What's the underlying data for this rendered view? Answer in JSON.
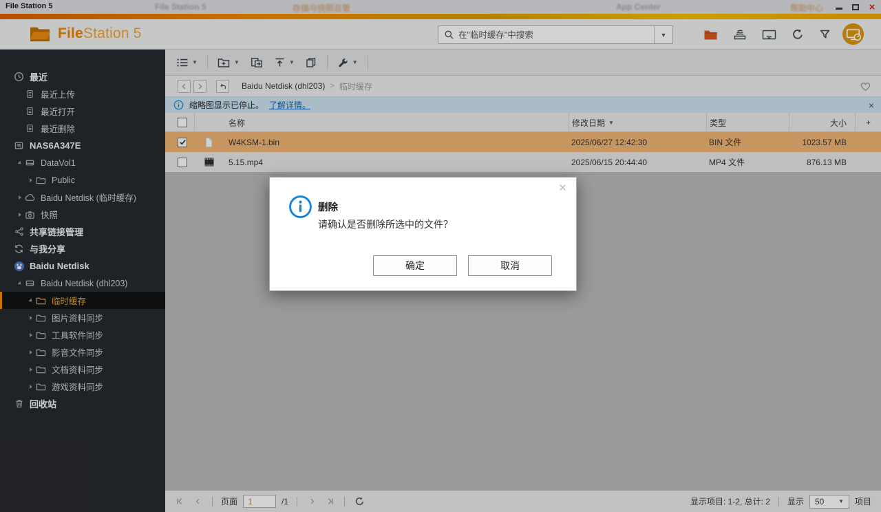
{
  "colors": {
    "accent_orange": "#ef8a00",
    "logo_orange": "#e98200",
    "selection_row": "#eeb273",
    "sidebar_bg": "#26292e",
    "sidebar_selected_text": "#e8a33d",
    "banner_bg": "#cae1ef",
    "link_blue": "#1763a6",
    "info_blue": "#1583d6",
    "close_red": "#c42b1c"
  },
  "titlebar": {
    "title": "File Station 5",
    "ghost_windows": [
      "File Station 5",
      "存储与快照总管",
      "App Center",
      "帮助中心"
    ]
  },
  "header": {
    "logo_bold": "File",
    "logo_rest": "Station 5",
    "search_placeholder": "在\"临时缓存\"中搜索",
    "action_icons": [
      {
        "name": "remote-folder-icon",
        "icon": "remote-folder"
      },
      {
        "name": "background-tasks-icon",
        "icon": "bg-task"
      },
      {
        "name": "play-to-device-icon",
        "icon": "cast"
      },
      {
        "name": "refresh-icon",
        "icon": "refresh"
      },
      {
        "name": "filter-icon",
        "icon": "filter"
      },
      {
        "name": "more-actions-icon",
        "icon": "more-dots"
      }
    ]
  },
  "toolbar": {
    "buttons": [
      {
        "name": "view-mode-button",
        "icon": "list-view",
        "dropdown": true
      },
      {
        "name": "create-folder-button",
        "icon": "new-folder",
        "dropdown": true
      },
      {
        "name": "copy-move-button",
        "icon": "copy-move",
        "dropdown": false
      },
      {
        "name": "upload-button",
        "icon": "upload",
        "dropdown": true
      },
      {
        "name": "copy-button",
        "icon": "copy",
        "dropdown": false
      },
      {
        "name": "tools-button",
        "icon": "wrench",
        "dropdown": true
      }
    ]
  },
  "breadcrumb": {
    "parent": "Baidu Netdisk (dhl203)",
    "separator": ">",
    "current": "临时缓存"
  },
  "banner": {
    "text": "缩略图显示已停止。",
    "link_text": "了解详情。"
  },
  "table": {
    "columns": [
      {
        "label": "名称",
        "sorted": false
      },
      {
        "label": "修改日期",
        "sorted": true
      },
      {
        "label": "类型",
        "sorted": false
      },
      {
        "label": "大小",
        "sorted": false
      }
    ],
    "add_column_label": "+",
    "rows": [
      {
        "name": "W4KSM-1.bin",
        "date": "2025/06/27 12:42:30",
        "type": "BIN 文件",
        "size": "1023.57 MB",
        "icon": "file",
        "checked": true,
        "selected": true
      },
      {
        "name": "5.15.mp4",
        "date": "2025/06/15 20:44:40",
        "type": "MP4 文件",
        "size": "876.13 MB",
        "icon": "video",
        "checked": false,
        "selected": false
      }
    ]
  },
  "sidebar": {
    "items": [
      {
        "label": "最近",
        "level": 0,
        "icon": "clock",
        "bold": true,
        "arrow": "none",
        "selected": false
      },
      {
        "label": "最近上传",
        "level": 1,
        "icon": "doc",
        "bold": false,
        "arrow": "none",
        "selected": false
      },
      {
        "label": "最近打开",
        "level": 1,
        "icon": "doc",
        "bold": false,
        "arrow": "none",
        "selected": false
      },
      {
        "label": "最近删除",
        "level": 1,
        "icon": "doc",
        "bold": false,
        "arrow": "none",
        "selected": false
      },
      {
        "label": "NAS6A347E",
        "level": 0,
        "icon": "nas",
        "bold": true,
        "arrow": "none",
        "selected": false
      },
      {
        "label": "DataVol1",
        "level": 1,
        "icon": "volume",
        "bold": false,
        "arrow": "expanded",
        "selected": false
      },
      {
        "label": "Public",
        "level": 2,
        "icon": "folder",
        "bold": false,
        "arrow": "collapsed",
        "selected": false
      },
      {
        "label": "Baidu Netdisk (临时缓存)",
        "level": 1,
        "icon": "cloud",
        "bold": false,
        "arrow": "collapsed",
        "selected": false
      },
      {
        "label": "快照",
        "level": 1,
        "icon": "snapshot",
        "bold": false,
        "arrow": "collapsed",
        "selected": false
      },
      {
        "label": "共享链接管理",
        "level": 0,
        "icon": "share",
        "bold": true,
        "arrow": "none",
        "selected": false
      },
      {
        "label": "与我分享",
        "level": 0,
        "icon": "shared-with-me",
        "bold": true,
        "arrow": "none",
        "selected": false
      },
      {
        "label": "Baidu Netdisk",
        "level": 0,
        "icon": "baidu",
        "bold": true,
        "arrow": "none",
        "selected": false
      },
      {
        "label": "Baidu Netdisk (dhl203)",
        "level": 1,
        "icon": "volume",
        "bold": false,
        "arrow": "expanded",
        "selected": false
      },
      {
        "label": "临时缓存",
        "level": 2,
        "icon": "folder",
        "bold": false,
        "arrow": "expanded",
        "selected": true
      },
      {
        "label": "图片资料同步",
        "level": 2,
        "icon": "folder",
        "bold": false,
        "arrow": "collapsed",
        "selected": false
      },
      {
        "label": "工具软件同步",
        "level": 2,
        "icon": "folder",
        "bold": false,
        "arrow": "collapsed",
        "selected": false
      },
      {
        "label": "影音文件同步",
        "level": 2,
        "icon": "folder",
        "bold": false,
        "arrow": "collapsed",
        "selected": false
      },
      {
        "label": "文档资料同步",
        "level": 2,
        "icon": "folder",
        "bold": false,
        "arrow": "collapsed",
        "selected": false
      },
      {
        "label": "游戏资料同步",
        "level": 2,
        "icon": "folder",
        "bold": false,
        "arrow": "collapsed",
        "selected": false
      },
      {
        "label": "回收站",
        "level": 0,
        "icon": "trash",
        "bold": true,
        "arrow": "none",
        "selected": false
      }
    ]
  },
  "dialog": {
    "title": "删除",
    "message": "请确认是否删除所选中的文件？",
    "ok_label": "确定",
    "cancel_label": "取消"
  },
  "statusbar": {
    "page_label": "页面",
    "page_value": "1",
    "page_total_label": "/1",
    "items_summary": "显示项目: 1-2, 总计: 2",
    "show_label": "显示",
    "page_size_value": "50",
    "unit_label": "项目"
  }
}
